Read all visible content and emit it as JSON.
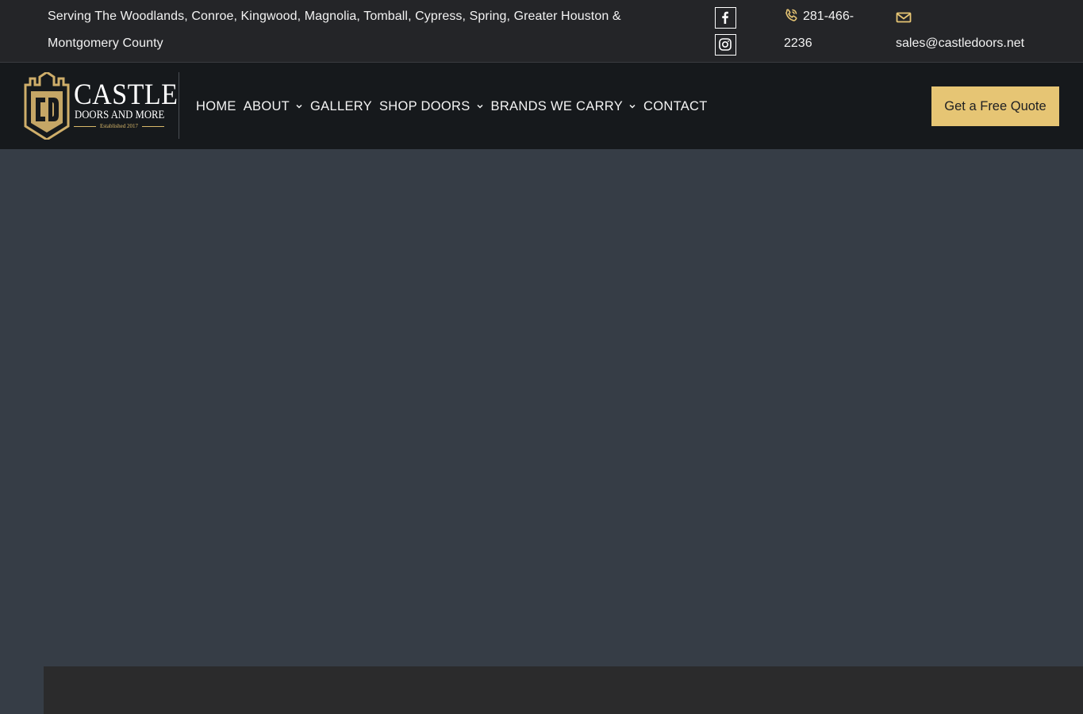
{
  "topbar": {
    "service_area": "Serving The Woodlands, Conroe, Kingwood, Magnolia, Tomball, Cypress, Spring, Greater Houston & Montgomery County",
    "phone": "281-466-2236",
    "phone_icon": "phone-icon",
    "email": "sales@castledoors.net",
    "email_icon": "mail-icon",
    "social": [
      "facebook-icon",
      "instagram-icon"
    ]
  },
  "header": {
    "logo": {
      "name": "CASTLE",
      "tagline": "DOORS AND MORE",
      "established": "Established 2017"
    },
    "nav": [
      {
        "label": "HOME",
        "dropdown": false
      },
      {
        "label": "ABOUT",
        "dropdown": true
      },
      {
        "label": "GALLERY",
        "dropdown": false
      },
      {
        "label": "SHOP DOORS",
        "dropdown": true
      },
      {
        "label": "BRANDS WE CARRY",
        "dropdown": true
      },
      {
        "label": "CONTACT",
        "dropdown": false
      }
    ],
    "cta": "Get a Free Quote"
  },
  "colors": {
    "accent_gold": "#e6c574",
    "topbar_bg": "#242528",
    "header_bg": "#16191c",
    "hero_bg": "#363d46",
    "panel_bg": "#2b2b2c"
  }
}
